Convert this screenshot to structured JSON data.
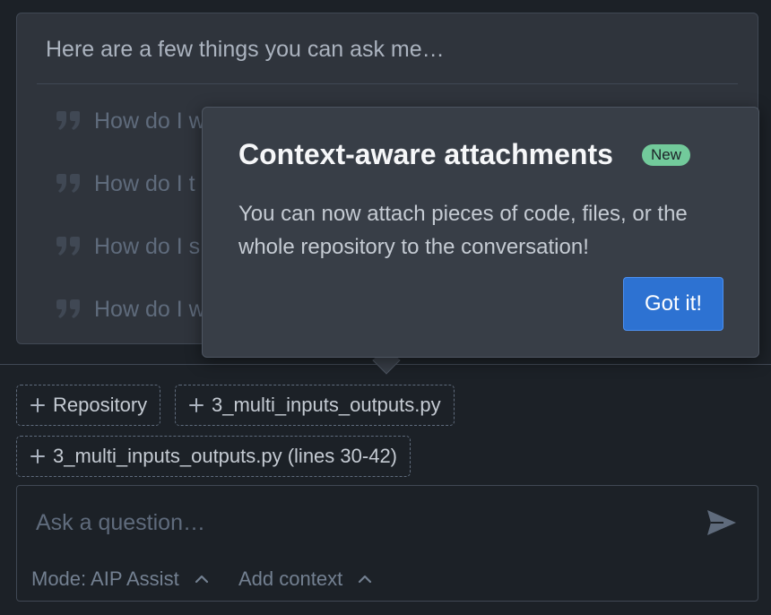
{
  "suggestions": {
    "heading": "Here are a few things you can ask me…",
    "items": [
      {
        "text": "How do I w"
      },
      {
        "text": "How do I t"
      },
      {
        "text": "How do I s"
      },
      {
        "text": "How do I w"
      }
    ]
  },
  "popover": {
    "title": "Context-aware attachments",
    "badge": "New",
    "body": "You can now attach pieces of code, files, or the whole repository to the conversation!",
    "button": "Got it!"
  },
  "context_chips": [
    {
      "label": "Repository"
    },
    {
      "label": "3_multi_inputs_outputs.py"
    },
    {
      "label": "3_multi_inputs_outputs.py (lines 30-42)"
    }
  ],
  "composer": {
    "placeholder": "Ask a question…",
    "value": "",
    "mode_label": "Mode: AIP Assist",
    "add_context_label": "Add context"
  },
  "colors": {
    "accent": "#2d72d2",
    "badge": "#72ca9b",
    "background": "#1c2127",
    "card": "#2f343c",
    "popover": "#383e47"
  },
  "icons": {
    "suggestion": "quote-icon",
    "chip": "plus-icon",
    "send": "send-icon",
    "dropdown": "chevron-up-icon"
  }
}
